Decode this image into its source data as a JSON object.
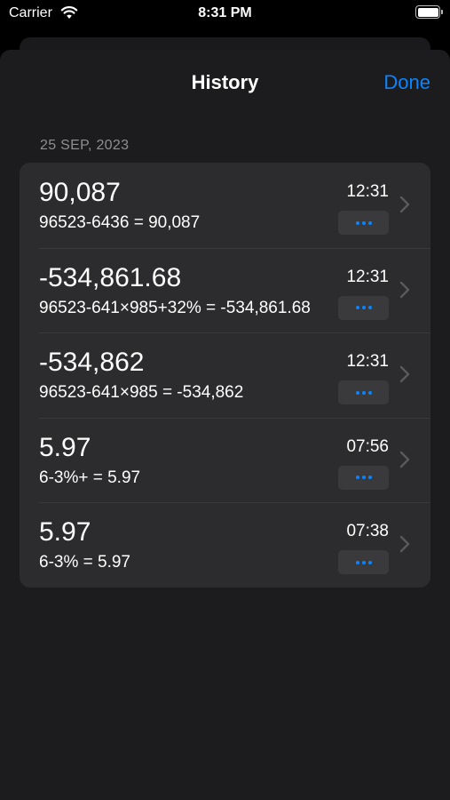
{
  "status_bar": {
    "carrier": "Carrier",
    "time": "8:31 PM"
  },
  "nav": {
    "title": "History",
    "done_label": "Done"
  },
  "section": {
    "date": "25 SEP, 2023"
  },
  "entries": [
    {
      "result": "90,087",
      "expression": "96523-6436 = 90,087",
      "time": "12:31"
    },
    {
      "result": "-534,861.68",
      "expression": "96523-641×985+32% = -534,861.68",
      "time": "12:31"
    },
    {
      "result": "-534,862",
      "expression": "96523-641×985 = -534,862",
      "time": "12:31"
    },
    {
      "result": "5.97",
      "expression": "6-3%+ = 5.97",
      "time": "07:56"
    },
    {
      "result": "5.97",
      "expression": "6-3% = 5.97",
      "time": "07:38"
    }
  ],
  "icons": {
    "more": "more-horizontal-icon",
    "chevron": "chevron-right-icon",
    "wifi": "wifi-icon",
    "battery": "battery-icon"
  },
  "colors": {
    "accent": "#0a84ff",
    "background": "#1c1c1e",
    "row_background": "#2c2c2e",
    "secondary_text": "#8e8e93"
  }
}
